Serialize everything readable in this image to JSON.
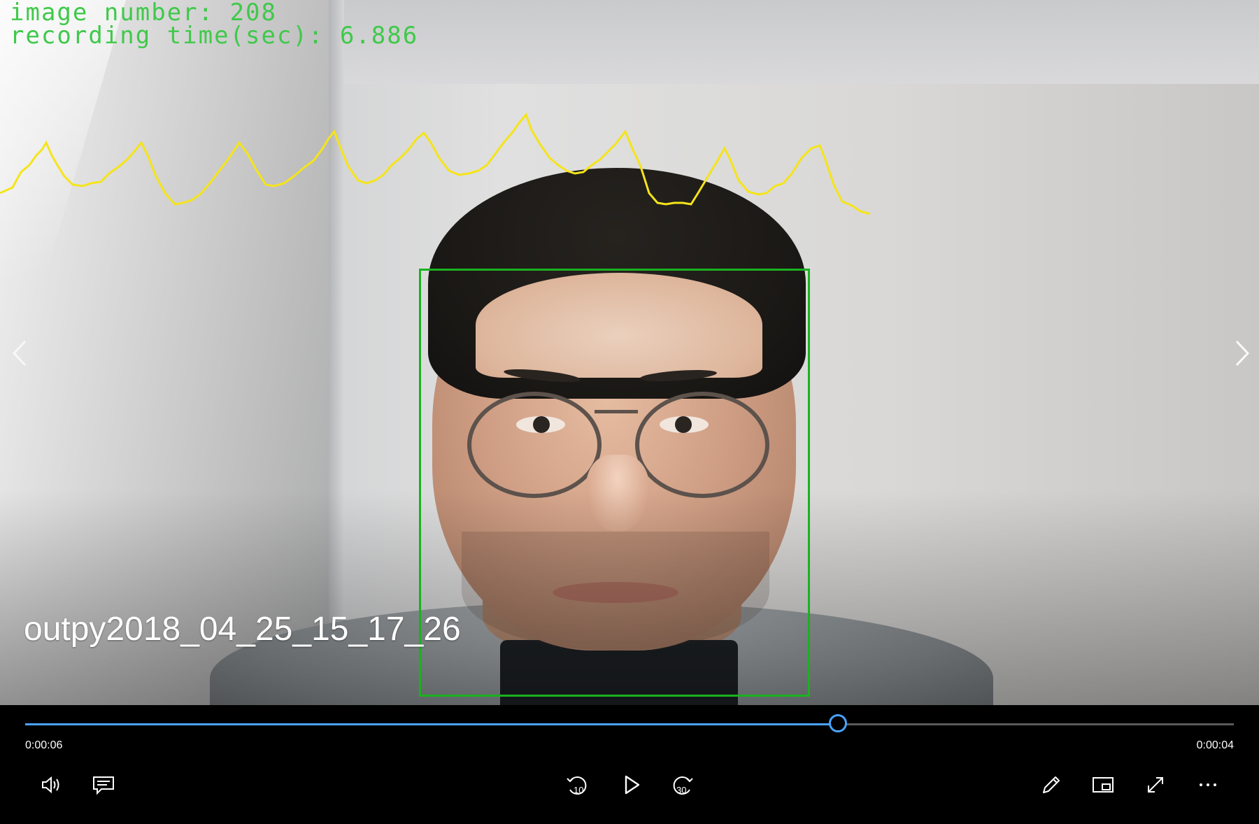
{
  "overlay": {
    "line1": "image number: 208",
    "line2": "recording time(sec): 6.886",
    "text_color": "#3fc94a",
    "signal_color": "#f5e41a",
    "box_color": "#19b21f"
  },
  "video": {
    "title": "outpy2018_04_25_15_17_26"
  },
  "player": {
    "elapsed": "0:00:06",
    "remaining": "0:00:04",
    "progress_fraction": 0.6725,
    "accent": "#4aa3ff"
  },
  "icons": {
    "prev": "chevron-left-icon",
    "next": "chevron-right-icon",
    "volume": "volume-icon",
    "captions": "captions-icon",
    "skip_back": "skip-back-10-icon",
    "play": "play-icon",
    "skip_forward": "skip-forward-30-icon",
    "edit": "pencil-icon",
    "mini_view": "mini-view-icon",
    "fullscreen": "fullscreen-icon",
    "more": "more-icon"
  },
  "labels": {
    "skip_back_num": "10",
    "skip_forward_num": "30"
  }
}
